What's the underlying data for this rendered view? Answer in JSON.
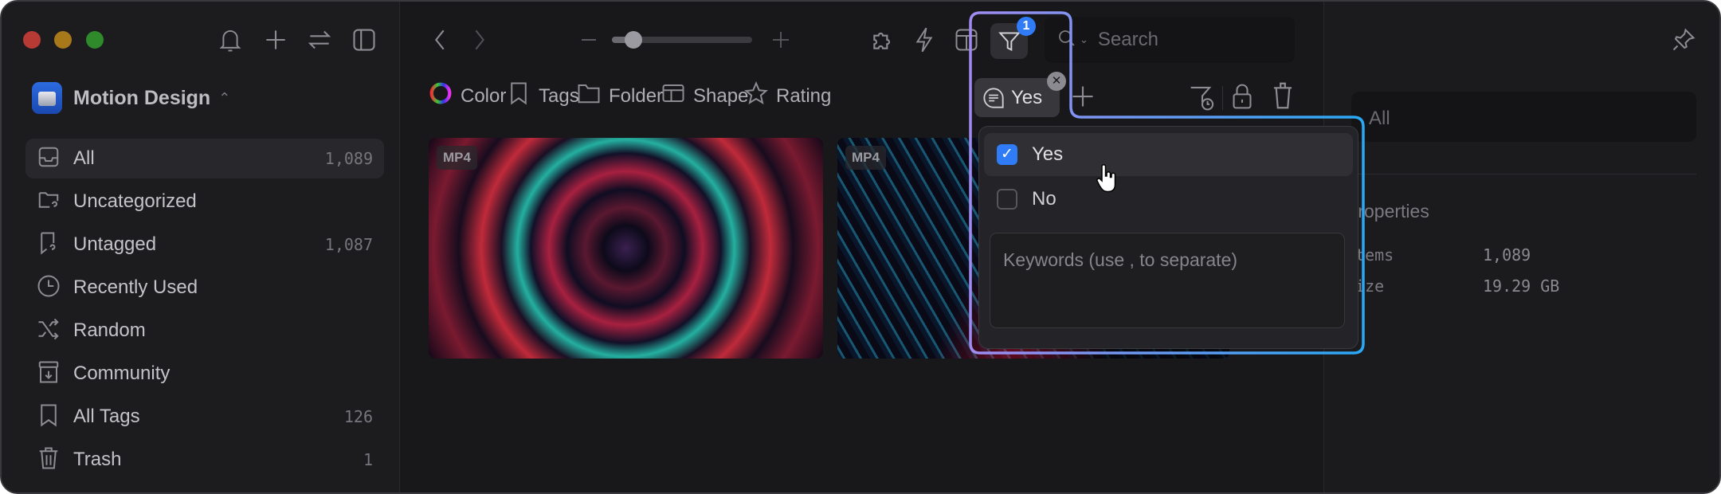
{
  "window": {
    "traffic_lights": {
      "close": "#b83a35",
      "minimize": "#a8791b",
      "zoom": "#2f8a2c"
    }
  },
  "sidebar": {
    "library": {
      "name": "Motion Design",
      "icon": "library-icon"
    },
    "header_icons": [
      "bell-icon",
      "plus-icon",
      "sync-icon",
      "sidebar-toggle-icon"
    ],
    "items": [
      {
        "label": "All",
        "count": "1,089",
        "icon": "inbox-icon",
        "selected": true
      },
      {
        "label": "Uncategorized",
        "count": "",
        "icon": "folder-question-icon"
      },
      {
        "label": "Untagged",
        "count": "1,087",
        "icon": "tag-question-icon"
      },
      {
        "label": "Recently Used",
        "count": "",
        "icon": "clock-icon"
      },
      {
        "label": "Random",
        "count": "",
        "icon": "shuffle-icon"
      },
      {
        "label": "Community",
        "count": "",
        "icon": "archive-download-icon"
      },
      {
        "label": "All Tags",
        "count": "126",
        "icon": "bookmark-icon"
      },
      {
        "label": "Trash",
        "count": "1",
        "icon": "trash-icon"
      }
    ]
  },
  "toolbar": {
    "zoom_slider_value": 0.15,
    "search_placeholder": "Search",
    "filter_badge": "1"
  },
  "filters": {
    "buttons": [
      {
        "label": "Color",
        "icon": "color-wheel-icon"
      },
      {
        "label": "Tags",
        "icon": "tag-icon"
      },
      {
        "label": "Folder",
        "icon": "folder-icon"
      },
      {
        "label": "Shape",
        "icon": "shape-icon"
      },
      {
        "label": "Rating",
        "icon": "star-icon"
      }
    ],
    "active_chip": "Yes"
  },
  "thumbnails": [
    {
      "badge": "MP4"
    },
    {
      "badge": "MP4"
    }
  ],
  "dropdown": {
    "options": [
      {
        "label": "Yes",
        "checked": true
      },
      {
        "label": "No",
        "checked": false
      }
    ],
    "keywords_placeholder": "Keywords (use , to separate)",
    "accent": "#2f7cf6"
  },
  "inspector": {
    "field_value": "All",
    "section_title": "Properties",
    "rows": [
      {
        "label": "Items",
        "value": "1,089"
      },
      {
        "label": "Size",
        "value": "19.29 GB"
      }
    ]
  }
}
